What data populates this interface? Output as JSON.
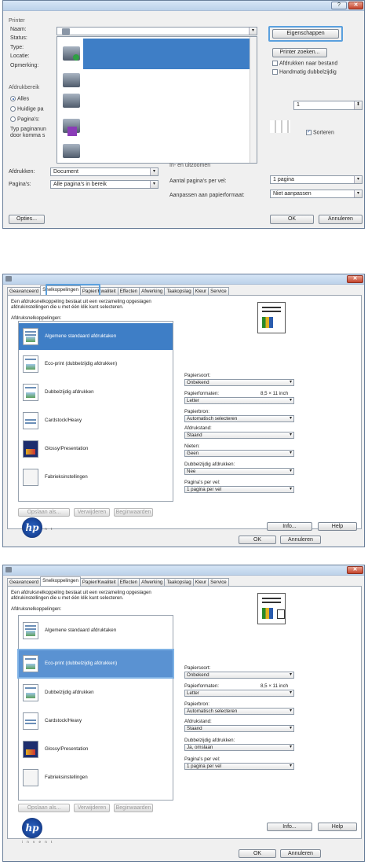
{
  "dialog1": {
    "title_buttons": [
      "?",
      "✕"
    ],
    "printer_section": "Printer",
    "name_label": "Naam:",
    "status_label": "Status:",
    "type_label": "Type:",
    "location_label": "Locatie:",
    "comment_label": "Opmerking:",
    "properties_button": "Eigenschappen",
    "find_printer_button": "Printer zoeken...",
    "print_to_file": "Afdrukken naar bestand",
    "manual_duplex": "Handmatig dubbelzijdig",
    "range_section": "Afdrukbereik",
    "range_all": "Alles",
    "range_current": "Huidige pa",
    "range_pages": "Pagina's:",
    "range_hint_1": "Typ paginanun",
    "range_hint_2": "door komma  s",
    "copies_value": "1",
    "collate": "Sorteren",
    "zoom_section": "In- en uitzoomen",
    "print_what_label": "Afdrukken:",
    "print_what_value": "Document",
    "print_label": "Pagina's:",
    "print_value": "Alle pagina's in bereik",
    "pages_per_sheet_label": "Aantal pagina's per vel:",
    "pages_per_sheet_value": "1 pagina",
    "scale_label": "Aanpassen aan papierformaat:",
    "scale_value": "Niet aanpassen",
    "options_button": "Opties...",
    "ok_button": "OK",
    "cancel_button": "Annuleren"
  },
  "dialog2": {
    "tabs": [
      "Geavanceerd",
      "Snelkoppelingen",
      "Papier/Kwaliteit",
      "Effecten",
      "Afwerking",
      "Taakopslag",
      "Kleur",
      "Service"
    ],
    "active_tab": "Snelkoppelingen",
    "intro_1": "Een afdruksnelkoppeling bestaat uit een verzameling opgeslagen",
    "intro_2": "afdrukinstellingen die u met één klik kunt selecteren.",
    "shortcuts_label": "Afdruksnelkoppelingen:",
    "shortcuts": [
      "Algemene standaard afdruktaken",
      "Eco-print (dubbelzijdig afdrukken)",
      "Dubbelzijdig afdrukken",
      "Cardstock/Heavy",
      "Glossy/Presentation",
      "Fabrieksinstellingen"
    ],
    "paper_type_label": "Papiersoort:",
    "paper_type_value": "Onbekend",
    "paper_size_label": "Papierformaten:",
    "paper_size_dims": "8,5 × 11 inch",
    "paper_size_value": "Letter",
    "paper_source_label": "Papierbron:",
    "paper_source_value": "Automatisch selecteren",
    "orientation_label": "Afdrukstand:",
    "orientation_value": "Staand",
    "staple_label": "Nieten:",
    "staple_value": "Geen",
    "duplex_label": "Dubbelzijdig afdrukken:",
    "duplex_value": "Nee",
    "pps_label": "Pagina's per vel:",
    "pps_value": "1 pagina per vel",
    "save_as_button": "Opslaan als...",
    "delete_button": "Verwijderen",
    "reset_button": "Beginwaarden",
    "info_button": "Info...",
    "help_button": "Help",
    "ok_button": "OK",
    "cancel_button": "Annuleren",
    "logo_text": "hp",
    "invent": "i n v e n t"
  },
  "dialog3": {
    "tabs": [
      "Geavanceerd",
      "Snelkoppelingen",
      "Papier/Kwaliteit",
      "Effecten",
      "Afwerking",
      "Taakopslag",
      "Kleur",
      "Service"
    ],
    "intro_1": "Een afdruksnelkoppeling bestaat uit een verzameling opgeslagen",
    "intro_2": "afdrukinstellingen die u met één klik kunt selecteren.",
    "shortcuts_label": "Afdruksnelkoppelingen:",
    "shortcuts": [
      "Algemene standaard afdruktaken",
      "Eco-print (dubbelzijdig afdrukken)",
      "Dubbelzijdig afdrukken",
      "Cardstock/Heavy",
      "Glossy/Presentation",
      "Fabrieksinstellingen"
    ],
    "paper_type_label": "Papiersoort:",
    "paper_type_value": "Onbekend",
    "paper_size_label": "Papierformaten:",
    "paper_size_dims": "8,5 × 11 inch",
    "paper_size_value": "Letter",
    "paper_source_label": "Papierbron:",
    "paper_source_value": "Automatisch selecteren",
    "orientation_label": "Afdrukstand:",
    "orientation_value": "Staand",
    "duplex_label": "Dubbelzijdig afdrukken:",
    "duplex_value": "Ja, omslaan",
    "pps_label": "Pagina's per vel:",
    "pps_value": "1 pagina per vel",
    "save_as_button": "Opslaan als...",
    "delete_button": "Verwijderen",
    "reset_button": "Beginwaarden",
    "info_button": "Info...",
    "help_button": "Help",
    "ok_button": "OK",
    "cancel_button": "Annuleren",
    "logo_text": "hp",
    "invent": "i n v e n t"
  }
}
